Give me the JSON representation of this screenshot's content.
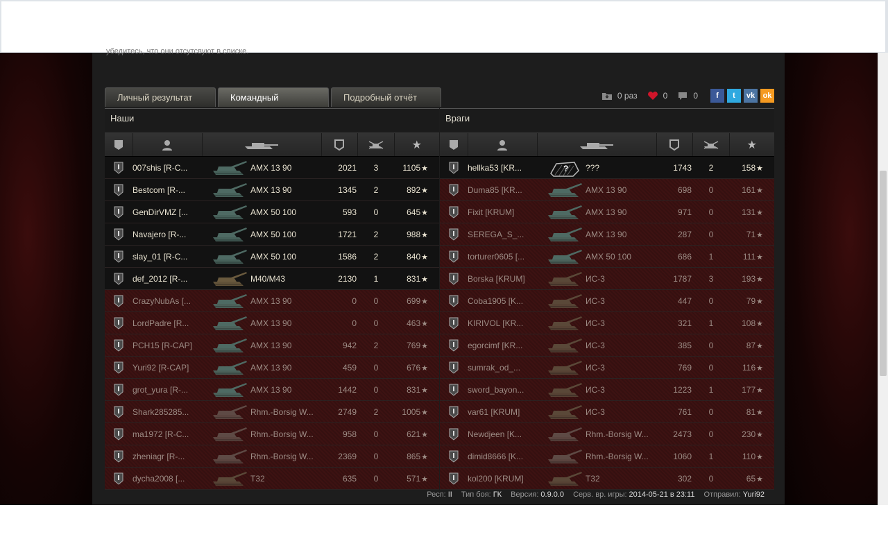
{
  "tabs": [
    "Личный результат",
    "Командный результат",
    "Подробный отчёт"
  ],
  "active_tab": 1,
  "social": {
    "saves": "0 раз",
    "likes": "0",
    "comments": "0",
    "fb": "f",
    "tw": "t",
    "vk": "vk",
    "ok": "ok"
  },
  "clipped_text": "убедитесь, что они отсутсвуют в списке.",
  "allies": {
    "title": "Наши",
    "rows": [
      {
        "name": "007shis [R-C...",
        "tank": "AMX 13 90",
        "dmg": "2021",
        "kills": "3",
        "xp": "1105",
        "alive": true,
        "color": "light"
      },
      {
        "name": "Bestcom [R-...",
        "tank": "AMX 13 90",
        "dmg": "1345",
        "kills": "2",
        "xp": "892",
        "alive": true,
        "color": "light"
      },
      {
        "name": "GenDirVMZ [...",
        "tank": "AMX 50 100",
        "dmg": "593",
        "kills": "0",
        "xp": "645",
        "alive": true,
        "color": "light"
      },
      {
        "name": "Navajero [R-...",
        "tank": "AMX 50 100",
        "dmg": "1721",
        "kills": "2",
        "xp": "988",
        "alive": true,
        "color": "light"
      },
      {
        "name": "slay_01 [R-C...",
        "tank": "AMX 50 100",
        "dmg": "1586",
        "kills": "2",
        "xp": "840",
        "alive": true,
        "color": "light"
      },
      {
        "name": "def_2012 [R-...",
        "tank": "M40/M43",
        "dmg": "2130",
        "kills": "1",
        "xp": "831",
        "alive": true,
        "color": "arty"
      },
      {
        "name": "CrazyNubAs [...",
        "tank": "AMX 13 90",
        "dmg": "0",
        "kills": "0",
        "xp": "699",
        "alive": false,
        "color": "light"
      },
      {
        "name": "LordPadre [R...",
        "tank": "AMX 13 90",
        "dmg": "0",
        "kills": "0",
        "xp": "463",
        "alive": false,
        "color": "light"
      },
      {
        "name": "PCH15 [R-CAP]",
        "tank": "AMX 13 90",
        "dmg": "942",
        "kills": "2",
        "xp": "769",
        "alive": false,
        "color": "light"
      },
      {
        "name": "Yuri92 [R-CAP]",
        "tank": "AMX 13 90",
        "dmg": "459",
        "kills": "0",
        "xp": "676",
        "alive": false,
        "color": "light"
      },
      {
        "name": "grot_yura [R-...",
        "tank": "AMX 13 90",
        "dmg": "1442",
        "kills": "0",
        "xp": "831",
        "alive": false,
        "color": "light"
      },
      {
        "name": "Shark285285...",
        "tank": "Rhm.-Borsig W...",
        "dmg": "2749",
        "kills": "2",
        "xp": "1005",
        "alive": false,
        "color": "td"
      },
      {
        "name": "ma1972 [R-C...",
        "tank": "Rhm.-Borsig W...",
        "dmg": "958",
        "kills": "0",
        "xp": "621",
        "alive": false,
        "color": "td"
      },
      {
        "name": "zheniagr [R-...",
        "tank": "Rhm.-Borsig W...",
        "dmg": "2369",
        "kills": "0",
        "xp": "865",
        "alive": false,
        "color": "td"
      },
      {
        "name": "dycha2008 [...",
        "tank": "T32",
        "dmg": "635",
        "kills": "0",
        "xp": "571",
        "alive": false,
        "color": "heavy"
      }
    ]
  },
  "enemies": {
    "title": "Враги",
    "rows": [
      {
        "name": "hellka53 [KR...",
        "tank": "???",
        "dmg": "1743",
        "kills": "2",
        "xp": "158",
        "alive": true,
        "color": "unknown"
      },
      {
        "name": "Duma85 [KR...",
        "tank": "AMX 13 90",
        "dmg": "698",
        "kills": "0",
        "xp": "161",
        "alive": false,
        "color": "light"
      },
      {
        "name": "Fixit [KRUM]",
        "tank": "AMX 13 90",
        "dmg": "971",
        "kills": "0",
        "xp": "131",
        "alive": false,
        "color": "light"
      },
      {
        "name": "SEREGA_S_...",
        "tank": "AMX 13 90",
        "dmg": "287",
        "kills": "0",
        "xp": "71",
        "alive": false,
        "color": "light"
      },
      {
        "name": "torturer0605 [...",
        "tank": "AMX 50 100",
        "dmg": "686",
        "kills": "1",
        "xp": "111",
        "alive": false,
        "color": "light"
      },
      {
        "name": "Borska [KRUM]",
        "tank": "ИС-3",
        "dmg": "1787",
        "kills": "3",
        "xp": "193",
        "alive": false,
        "color": "heavy"
      },
      {
        "name": "Coba1905 [K...",
        "tank": "ИС-3",
        "dmg": "447",
        "kills": "0",
        "xp": "79",
        "alive": false,
        "color": "heavy"
      },
      {
        "name": "KIRIVOL [KR...",
        "tank": "ИС-3",
        "dmg": "321",
        "kills": "1",
        "xp": "108",
        "alive": false,
        "color": "heavy"
      },
      {
        "name": "egorcimf [KR...",
        "tank": "ИС-3",
        "dmg": "385",
        "kills": "0",
        "xp": "87",
        "alive": false,
        "color": "heavy"
      },
      {
        "name": "sumrak_od_...",
        "tank": "ИС-3",
        "dmg": "769",
        "kills": "0",
        "xp": "116",
        "alive": false,
        "color": "heavy"
      },
      {
        "name": "sword_bayon...",
        "tank": "ИС-3",
        "dmg": "1223",
        "kills": "1",
        "xp": "177",
        "alive": false,
        "color": "heavy"
      },
      {
        "name": "var61 [KRUM]",
        "tank": "ИС-3",
        "dmg": "761",
        "kills": "0",
        "xp": "81",
        "alive": false,
        "color": "heavy"
      },
      {
        "name": "Newdjeen [K...",
        "tank": "Rhm.-Borsig W...",
        "dmg": "2473",
        "kills": "0",
        "xp": "230",
        "alive": false,
        "color": "td"
      },
      {
        "name": "dimid8666 [K...",
        "tank": "Rhm.-Borsig W...",
        "dmg": "1060",
        "kills": "1",
        "xp": "110",
        "alive": false,
        "color": "td"
      },
      {
        "name": "kol200 [KRUM]",
        "tank": "T32",
        "dmg": "302",
        "kills": "0",
        "xp": "65",
        "alive": false,
        "color": "heavy"
      }
    ]
  },
  "footer": {
    "resp_label": "Респ:",
    "resp": "II",
    "type_label": "Тип боя:",
    "type": "ГК",
    "version_label": "Версия:",
    "version": "0.9.0.0",
    "server_label": "Серв. вр. игры:",
    "server": "2014-05-21 в 23:11",
    "sender_label": "Отправил:",
    "sender": "Yuri92"
  },
  "colors": {
    "light": "#4e6a63",
    "arty": "#6a5a3e",
    "td": "#5e4a45",
    "heavy": "#5a4838",
    "unknown": "#6b6b6b"
  }
}
